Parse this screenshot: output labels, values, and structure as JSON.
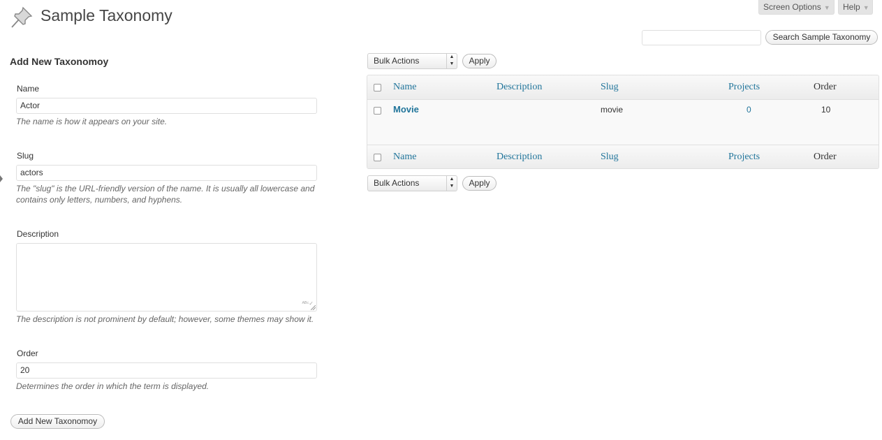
{
  "header": {
    "title": "Sample Taxonomy",
    "icon": "pushpin-icon",
    "screen_options_label": "Screen Options",
    "help_label": "Help",
    "search_button_label": "Search Sample Taxonomy",
    "search_value": ""
  },
  "form": {
    "heading": "Add New Taxonomoy",
    "name_label": "Name",
    "name_value": "Actor",
    "name_help": "The name is how it appears on your site.",
    "slug_label": "Slug",
    "slug_value": "actors",
    "slug_help_line1": "The \"slug\" is the URL-friendly version of the name. It is usually all lowercase and",
    "slug_help_line2": "contains only letters, numbers, and hyphens.",
    "description_label": "Description",
    "description_value": "",
    "description_help": "The description is not prominent by default; however, some themes may show it.",
    "order_label": "Order",
    "order_value": "20",
    "order_help": "Determines the order in which the term is displayed.",
    "submit_label": "Add New Taxonomoy"
  },
  "bulk": {
    "selected": "Bulk Actions",
    "apply_label": "Apply"
  },
  "table": {
    "columns": [
      "Name",
      "Description",
      "Slug",
      "Projects",
      "Order"
    ],
    "rows": [
      {
        "name": "Movie",
        "description": "",
        "slug": "movie",
        "projects": "0",
        "order": "10"
      }
    ]
  },
  "colors": {
    "link": "#21759b",
    "text": "#333333",
    "muted": "#666666"
  }
}
